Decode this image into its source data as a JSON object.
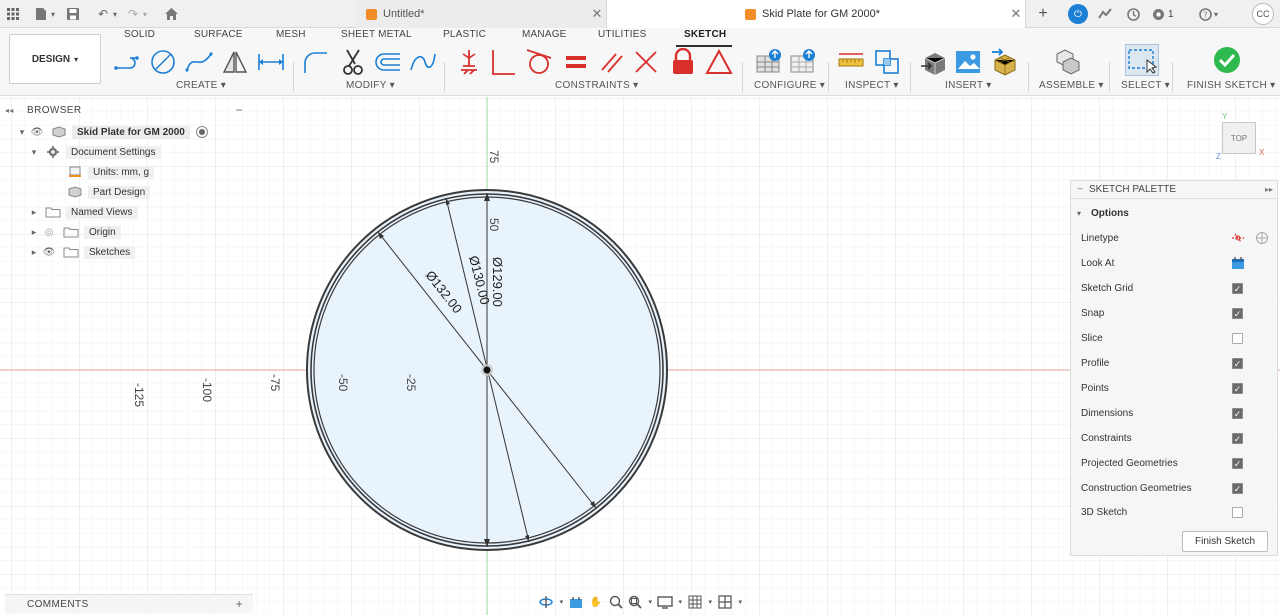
{
  "titlebar": {
    "tabs": [
      {
        "label": "Untitled*",
        "active": false
      },
      {
        "label": "Skid Plate for GM 2000*",
        "active": true
      }
    ],
    "notifications": "1",
    "user_initials": "CC"
  },
  "toolbar": {
    "workspace": "DESIGN",
    "workspace_tabs": [
      "SOLID",
      "SURFACE",
      "MESH",
      "SHEET METAL",
      "PLASTIC",
      "MANAGE",
      "UTILITIES",
      "SKETCH"
    ],
    "active_tab": "SKETCH",
    "groups": {
      "create": "CREATE",
      "modify": "MODIFY",
      "constraints": "CONSTRAINTS",
      "configure": "CONFIGURE",
      "inspect": "INSPECT",
      "insert": "INSERT",
      "assemble": "ASSEMBLE",
      "select": "SELECT",
      "finish": "FINISH SKETCH"
    },
    "colors": {
      "accent_red": "#d9302c",
      "accent_blue": "#1b7fd6",
      "finish_green": "#2fb84d"
    }
  },
  "browser": {
    "title": "BROWSER",
    "items": [
      {
        "label": "Skid Plate for GM 2000",
        "level": 0
      },
      {
        "label": "Document Settings",
        "level": 1
      },
      {
        "label": "Units: mm, g",
        "level": 2
      },
      {
        "label": "Part Design",
        "level": 2
      },
      {
        "label": "Named Views",
        "level": 1
      },
      {
        "label": "Origin",
        "level": 1
      },
      {
        "label": "Sketches",
        "level": 1
      }
    ]
  },
  "canvas": {
    "ruler_x": [
      "-125",
      "-100",
      "-75",
      "-50",
      "-25"
    ],
    "ruler_y": [
      "75",
      "50"
    ],
    "dimensions": [
      "Ø132.00",
      "Ø130.00",
      "Ø129.00"
    ],
    "view_cube": "TOP"
  },
  "palette": {
    "title": "SKETCH PALETTE",
    "section": "Options",
    "rows": [
      {
        "label": "Linetype",
        "type": "icon"
      },
      {
        "label": "Look At",
        "type": "icon"
      },
      {
        "label": "Sketch Grid",
        "type": "check",
        "checked": true
      },
      {
        "label": "Snap",
        "type": "check",
        "checked": true
      },
      {
        "label": "Slice",
        "type": "check",
        "checked": false
      },
      {
        "label": "Profile",
        "type": "check",
        "checked": true
      },
      {
        "label": "Points",
        "type": "check",
        "checked": true
      },
      {
        "label": "Dimensions",
        "type": "check",
        "checked": true
      },
      {
        "label": "Constraints",
        "type": "check",
        "checked": true
      },
      {
        "label": "Projected Geometries",
        "type": "check",
        "checked": true
      },
      {
        "label": "Construction Geometries",
        "type": "check",
        "checked": true
      },
      {
        "label": "3D Sketch",
        "type": "check",
        "checked": false
      }
    ],
    "finish_button": "Finish Sketch"
  },
  "comments": {
    "title": "COMMENTS"
  }
}
